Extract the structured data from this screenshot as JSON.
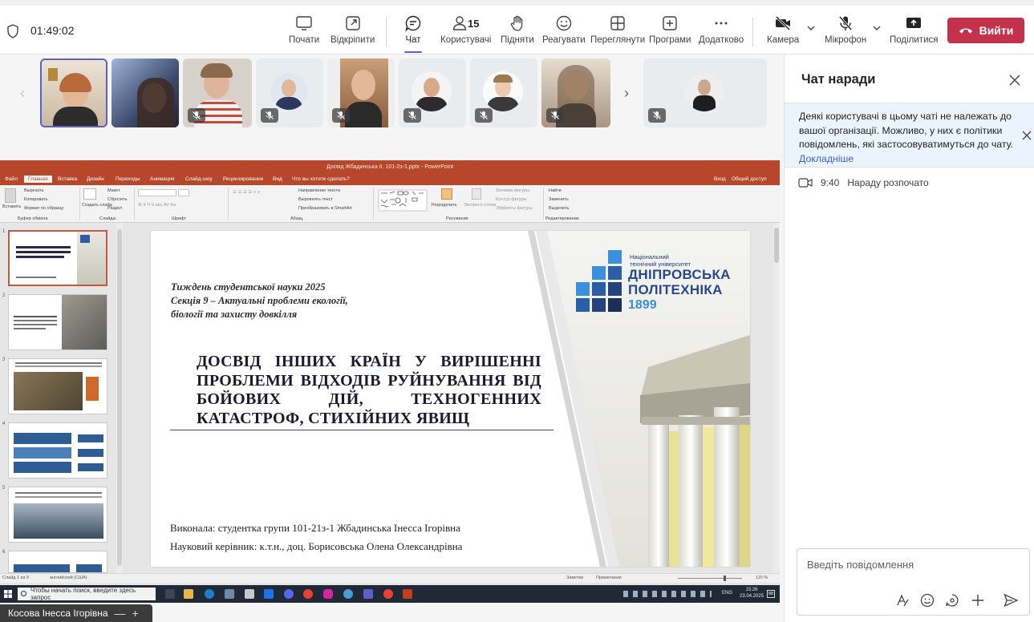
{
  "toolbar": {
    "timer": "01:49:02",
    "buttons": {
      "start": "Почати",
      "popout": "Відкріпити",
      "chat": "Чат",
      "people": "Користувачі",
      "people_count": "15",
      "raise": "Підняти",
      "react": "Реагувати",
      "view": "Переглянути",
      "apps": "Програми",
      "more": "Додатково",
      "camera": "Камера",
      "mic": "Мікрофон",
      "share": "Поділитися"
    },
    "leave": "Вийти",
    "colors": {
      "accent": "#5b5fc7",
      "leave": "#c4314b"
    }
  },
  "ppt": {
    "window_title": "Досвід Жбадинська ІІ. 101-2з-1.pptx - PowerPoint",
    "menu": {
      "file": "Файл",
      "home": "Главная",
      "insert": "Вставка",
      "design": "Дизайн",
      "transitions": "Переходы",
      "animations": "Анимация",
      "slideshow": "Слайд-шоу",
      "review": "Рецензирование",
      "view": "Вид",
      "tellme": "Что вы хотите сделать?",
      "signin": "Вход",
      "share": "Общий доступ"
    },
    "ribbon": {
      "paste": "Вставить",
      "cut": "Вырезать",
      "copy": "Копировать",
      "format": "Формат по образцу",
      "clipboard": "Буфер обмена",
      "new_slide": "Создать слайд",
      "layout": "Макет",
      "reset": "Сбросить",
      "section": "Раздел",
      "slides": "Слайды",
      "font": "Шрифт",
      "text_dir": "Направление текста",
      "align_text": "Выровнять текст",
      "smartart": "Преобразовать в SmartArt",
      "paragraph": "Абзац",
      "arrange": "Упорядочить",
      "quick_styles": "Экспресс-стили",
      "drawing": "Рисование",
      "fill": "Заливка фигуры",
      "outline": "Контур фигуры",
      "effects": "Эффекты фигуры",
      "find": "Найти",
      "replace": "Заменить",
      "select": "Выделить",
      "editing": "Редактирование"
    },
    "thumbs": [
      "1",
      "2",
      "3",
      "4",
      "5",
      "6"
    ],
    "slide": {
      "sub1": "Тиждень студентської науки 2025",
      "sub2": "Секція 9 – Актуальні проблеми екології,",
      "sub3": "біології та захисту довкілля",
      "heading": "ДОСВІД ІНШИХ КРАЇН У ВИРІШЕННІ ПРОБЛЕМИ ВІДХОДІВ РУЙНУВАННЯ ВІД БОЙОВИХ ДІЙ, ТЕХНОГЕННИХ КАТАСТРОФ, СТИХІЙНИХ ЯВИЩ",
      "author": "Виконала: студентка групи 101-21з-1 Жбадинська Інесса Ігорівна",
      "supervisor": "Науковий керівник: к.т.н., доц. Борисовська Олена Олександрівна",
      "uni_line1": "Національний",
      "uni_line2": "технічний університет",
      "uni_big1": "ДНІПРОВСЬКА",
      "uni_big2": "ПОЛІТЕХНІКА",
      "uni_year": "1899"
    },
    "status": {
      "slide_of": "Слайд 1 из 9",
      "lang": "английский (США)",
      "notes": "Заметки",
      "comments": "Примечания",
      "zoom": "115 %"
    }
  },
  "windows": {
    "search_placeholder": "Чтобы начать поиск, введите здесь запрос",
    "lang": "ENG",
    "time": "15:26",
    "date": "23.04.2025"
  },
  "presenter": {
    "name": "Косова Інесса Ігорівна"
  },
  "chat": {
    "title": "Чат наради",
    "notice": "Деякі користувачі в цьому чаті не належать до вашої організації. Можливо, у них є політики повідомлень, які застосовуватимуться до чату.",
    "notice_link": "Докладніше",
    "sys_time": "9:40",
    "sys_text": "Нараду розпочато",
    "compose_placeholder": "Введіть повідомлення"
  }
}
